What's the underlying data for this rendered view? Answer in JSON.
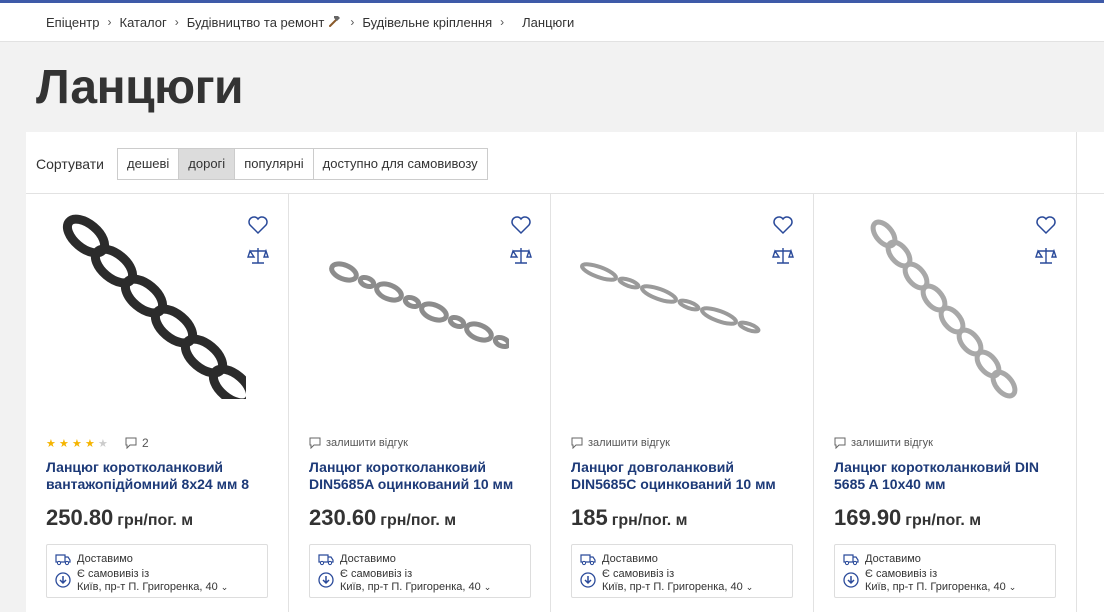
{
  "breadcrumbs": {
    "items": [
      "Епіцентр",
      "Каталог",
      "Будівництво та ремонт",
      "Будівельне кріплення"
    ],
    "current": "Ланцюги"
  },
  "page_title": "Ланцюги",
  "sort": {
    "label": "Сортувати",
    "options": [
      "дешеві",
      "дорогі",
      "популярні",
      "доступно для самовивозу"
    ],
    "active": "дорогі"
  },
  "products": [
    {
      "name": "Ланцюг коротколанковий вантажопідйомний 8х24 мм 8",
      "price": "250.80",
      "unit": "грн/пог. м",
      "rating": 4,
      "reviews_count": "2",
      "review_link": "",
      "delivery_label": "Доставимо",
      "pickup_label": "Є самовивіз із",
      "pickup_address": "Київ, пр-т П. Григоренка, 40",
      "image": "black-chain"
    },
    {
      "name": "Ланцюг коротколанковий DIN5685A оцинкований 10 мм",
      "price": "230.60",
      "unit": "грн/пог. м",
      "review_link": "залишити відгук",
      "delivery_label": "Доставимо",
      "pickup_label": "Є самовивіз із",
      "pickup_address": "Київ, пр-т П. Григоренка, 40",
      "image": "galvanized-chain"
    },
    {
      "name": "Ланцюг довголанковий DIN5685C оцинкований 10 мм",
      "price": "185",
      "unit": "грн/пог. м",
      "review_link": "залишити відгук",
      "delivery_label": "Доставимо",
      "pickup_label": "Є самовивіз із",
      "pickup_address": "Київ, пр-т П. Григоренка, 40",
      "image": "long-link-chain"
    },
    {
      "name": "Ланцюг коротколанковий DIN 5685 A 10х40 мм",
      "price": "169.90",
      "unit": "грн/пог. м",
      "review_link": "залишити відгук",
      "delivery_label": "Доставимо",
      "pickup_label": "Є самовивіз із",
      "pickup_address": "Київ, пр-т П. Григоренка, 40",
      "image": "steel-chain"
    }
  ],
  "colors": {
    "accent": "#1d3a78",
    "star": "#f5b400",
    "icon": "#2a4a9a"
  }
}
